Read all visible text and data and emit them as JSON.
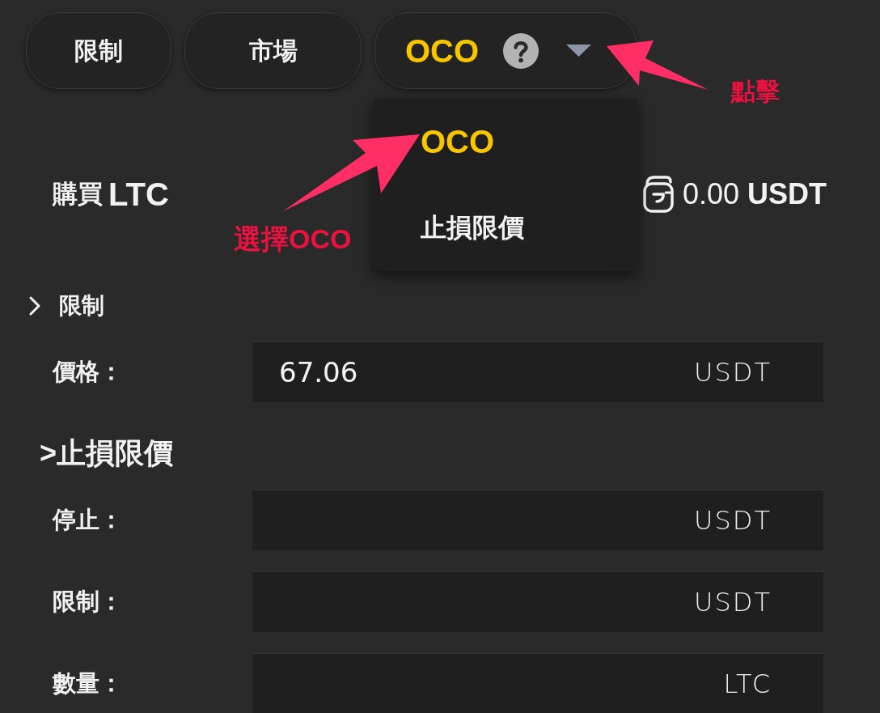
{
  "tabs": [
    {
      "kind": "tab",
      "label": "限制",
      "selected": false
    },
    {
      "kind": "tab",
      "label": "市場",
      "selected": false
    },
    {
      "kind": "dropdown",
      "label": "OCO",
      "selected": true,
      "expanded": true,
      "options": [
        {
          "label": "OCO",
          "selected": true
        },
        {
          "label": "止損限價",
          "selected": false
        }
      ]
    }
  ],
  "annotations": [
    {
      "kind": "click",
      "text": "點擊"
    },
    {
      "kind": "select",
      "text": "選擇OCO"
    }
  ],
  "order": {
    "action": "購買",
    "asset": "LTC",
    "balance": "0.00 **USDT**"
  },
  "sections": [
    {
      "kind": "chevron",
      "title": "限制",
      "fields": [
        {
          "label": "價格：",
          "value": "67.06",
          "unit": "USDT"
        }
      ]
    },
    {
      "kind": "plain",
      "title": ">止損限價",
      "fields": [
        {
          "label": "停止：",
          "unit": "USDT"
        },
        {
          "label": "限制：",
          "unit": "USDT"
        },
        {
          "label": "數量：",
          "unit": "LTC"
        }
      ]
    }
  ]
}
